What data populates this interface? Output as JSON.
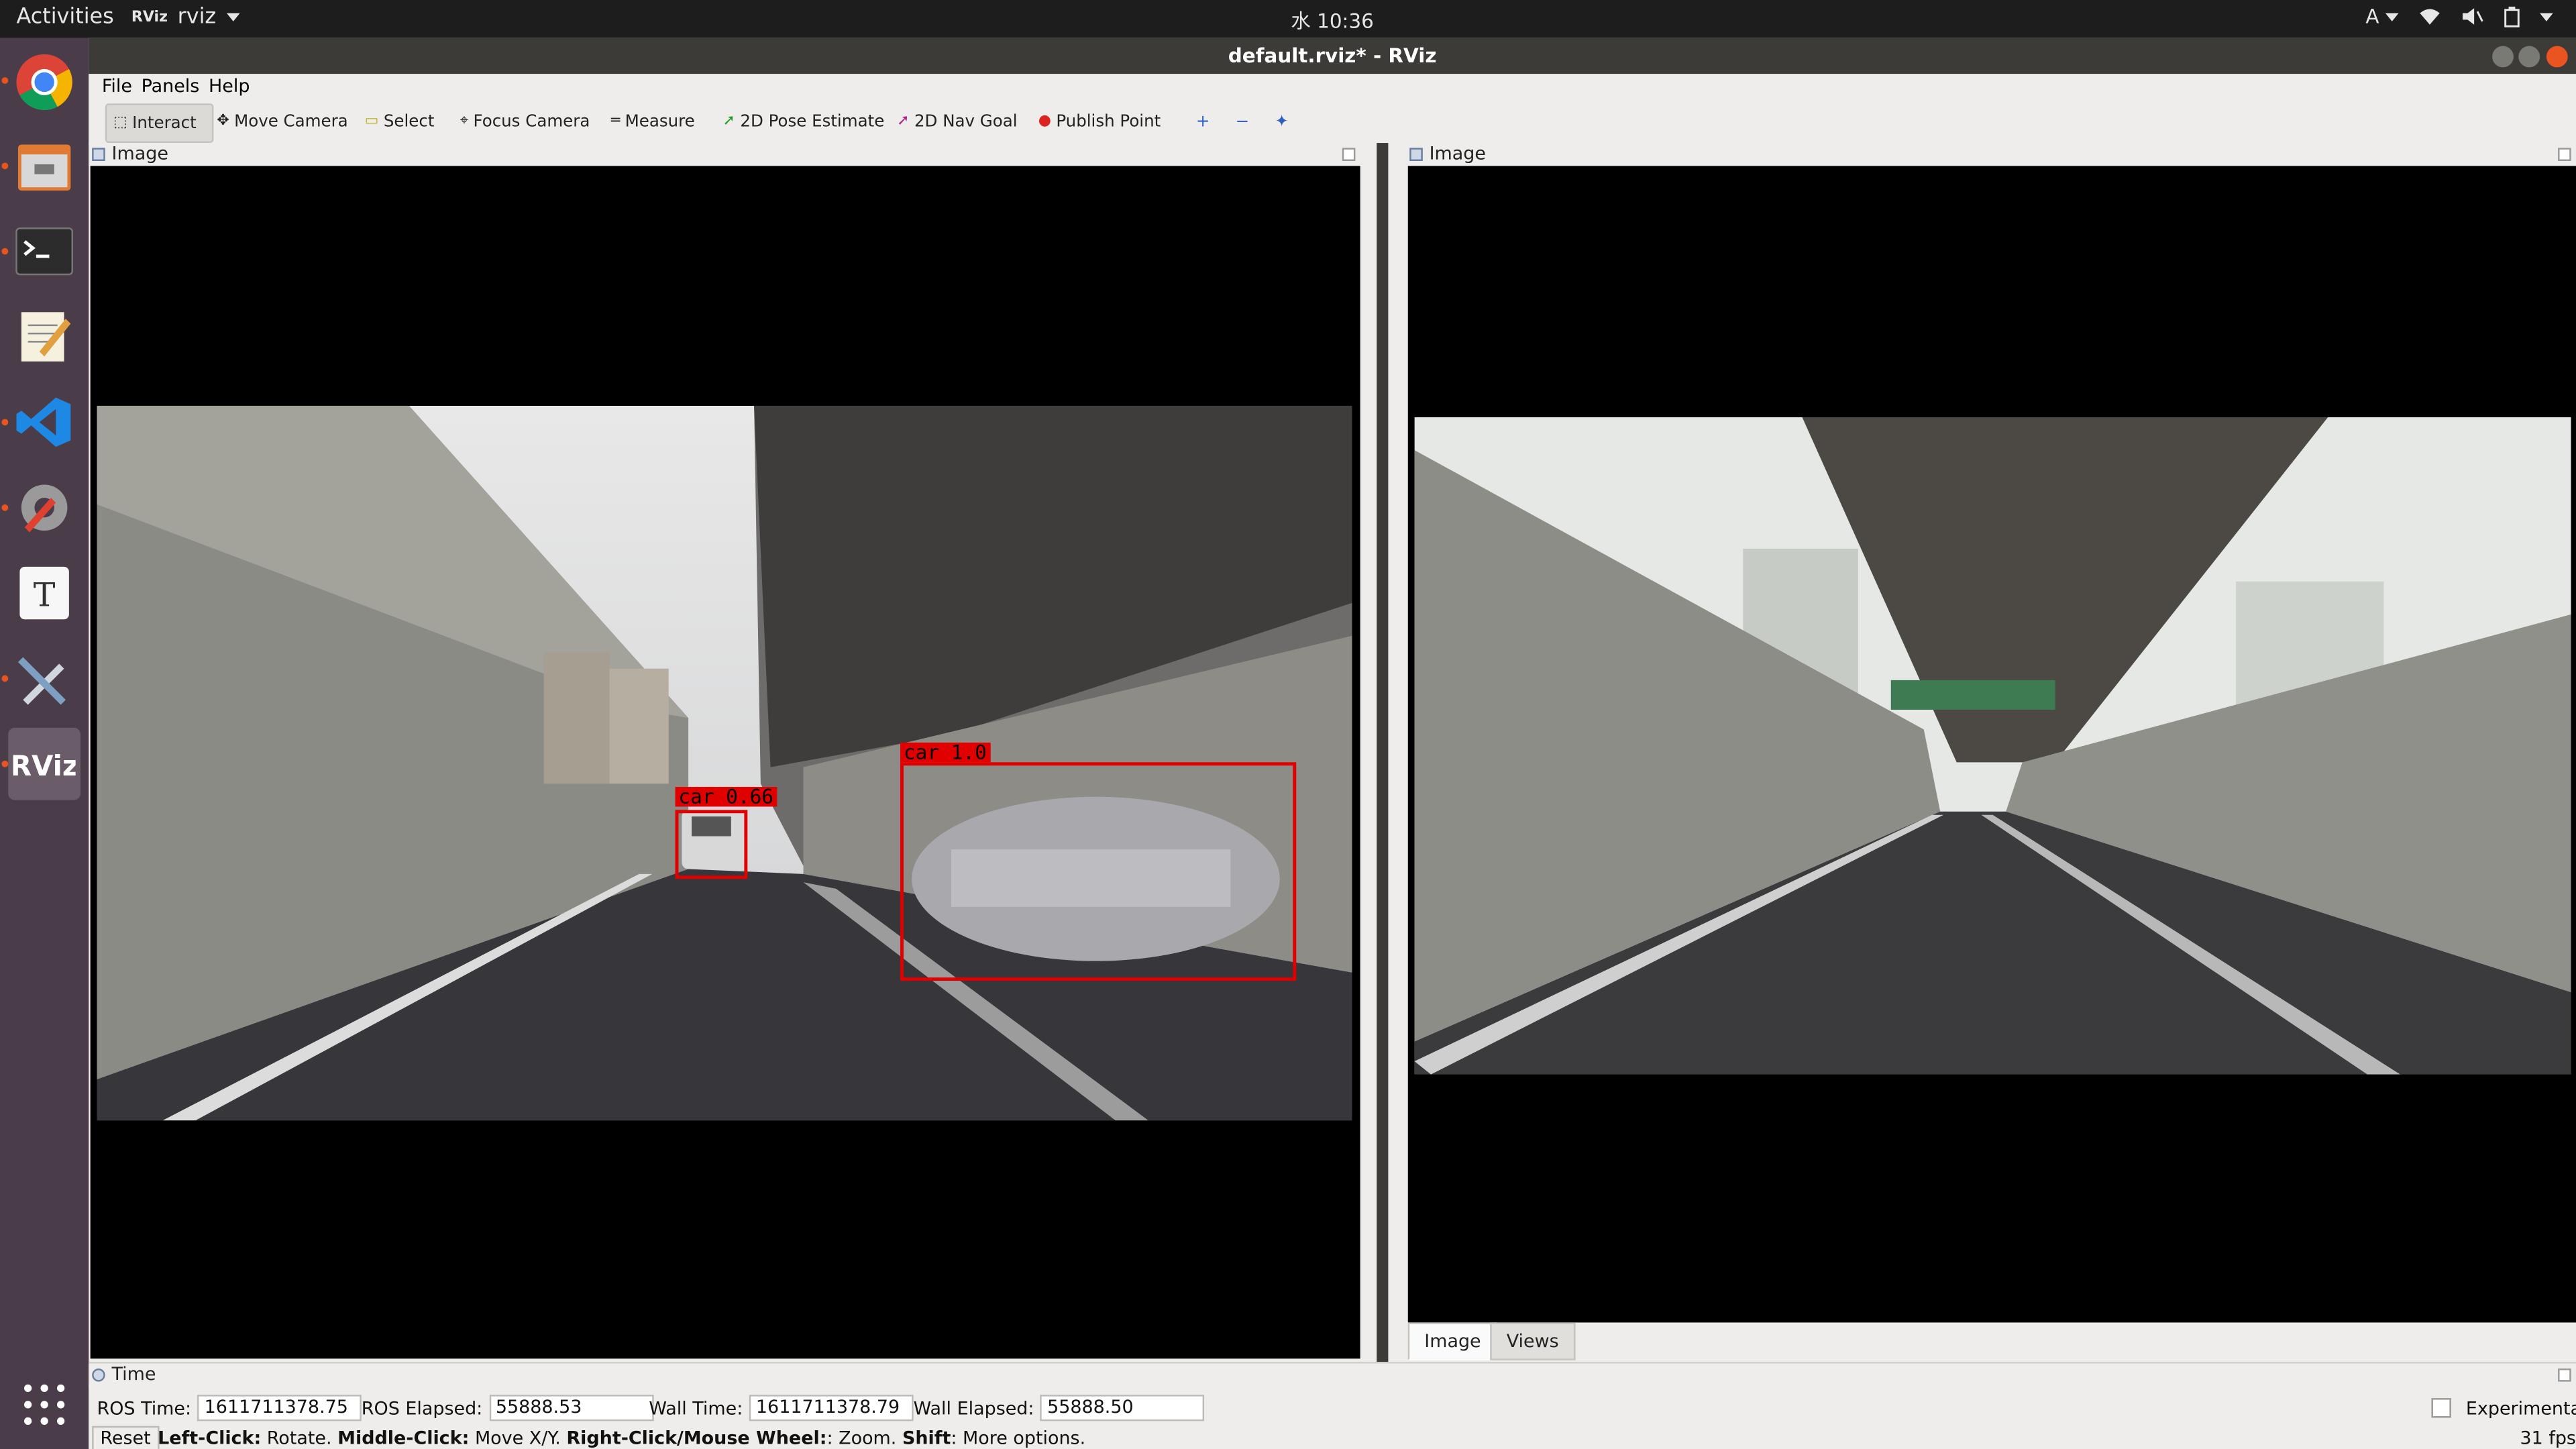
{
  "topbar": {
    "activities": "Activities",
    "app_logo": "RViz",
    "app_name": "rviz",
    "clock": "水 10:36",
    "input_method": "A"
  },
  "window": {
    "title": "default.rviz* - RViz"
  },
  "menu": {
    "file": "File",
    "panels": "Panels",
    "help": "Help"
  },
  "toolbar": {
    "interact": "Interact",
    "move_camera": "Move Camera",
    "select": "Select",
    "focus_camera": "Focus Camera",
    "measure": "Measure",
    "pose_estimate": "2D Pose Estimate",
    "nav_goal": "2D Nav Goal",
    "publish_point": "Publish Point"
  },
  "left_panel": {
    "title": "Image",
    "detections": [
      {
        "label": "car 0.66"
      },
      {
        "label": "car 1.0"
      }
    ]
  },
  "right_panel": {
    "title": "Image",
    "tabs": [
      "Image",
      "Views"
    ]
  },
  "time_panel": {
    "title": "Time",
    "ros_time_label": "ROS Time:",
    "ros_time": "1611711378.75",
    "ros_elapsed_label": "ROS Elapsed:",
    "ros_elapsed": "55888.53",
    "wall_time_label": "Wall Time:",
    "wall_time": "1611711378.79",
    "wall_elapsed_label": "Wall Elapsed:",
    "wall_elapsed": "55888.50",
    "experimental": "Experimental"
  },
  "statusbar": {
    "reset": "Reset",
    "h1": "Left-Click:",
    "t1": " Rotate. ",
    "h2": "Middle-Click:",
    "t2": " Move X/Y. ",
    "h3": "Right-Click/Mouse Wheel:",
    "t3": ": Zoom. ",
    "h4": "Shift",
    "t4": ": More options.",
    "fps": "31 fps"
  },
  "colors": {
    "accent": "#e95420",
    "detection": "#e10000",
    "dock_bg": "#4a3d49"
  },
  "dock_icons": [
    "chrome-icon",
    "files-icon",
    "terminal-icon",
    "text-editor-icon",
    "vscode-icon",
    "settings-tools-icon",
    "typora-icon",
    "tools-icon",
    "rviz-icon",
    "app-grid-icon"
  ]
}
